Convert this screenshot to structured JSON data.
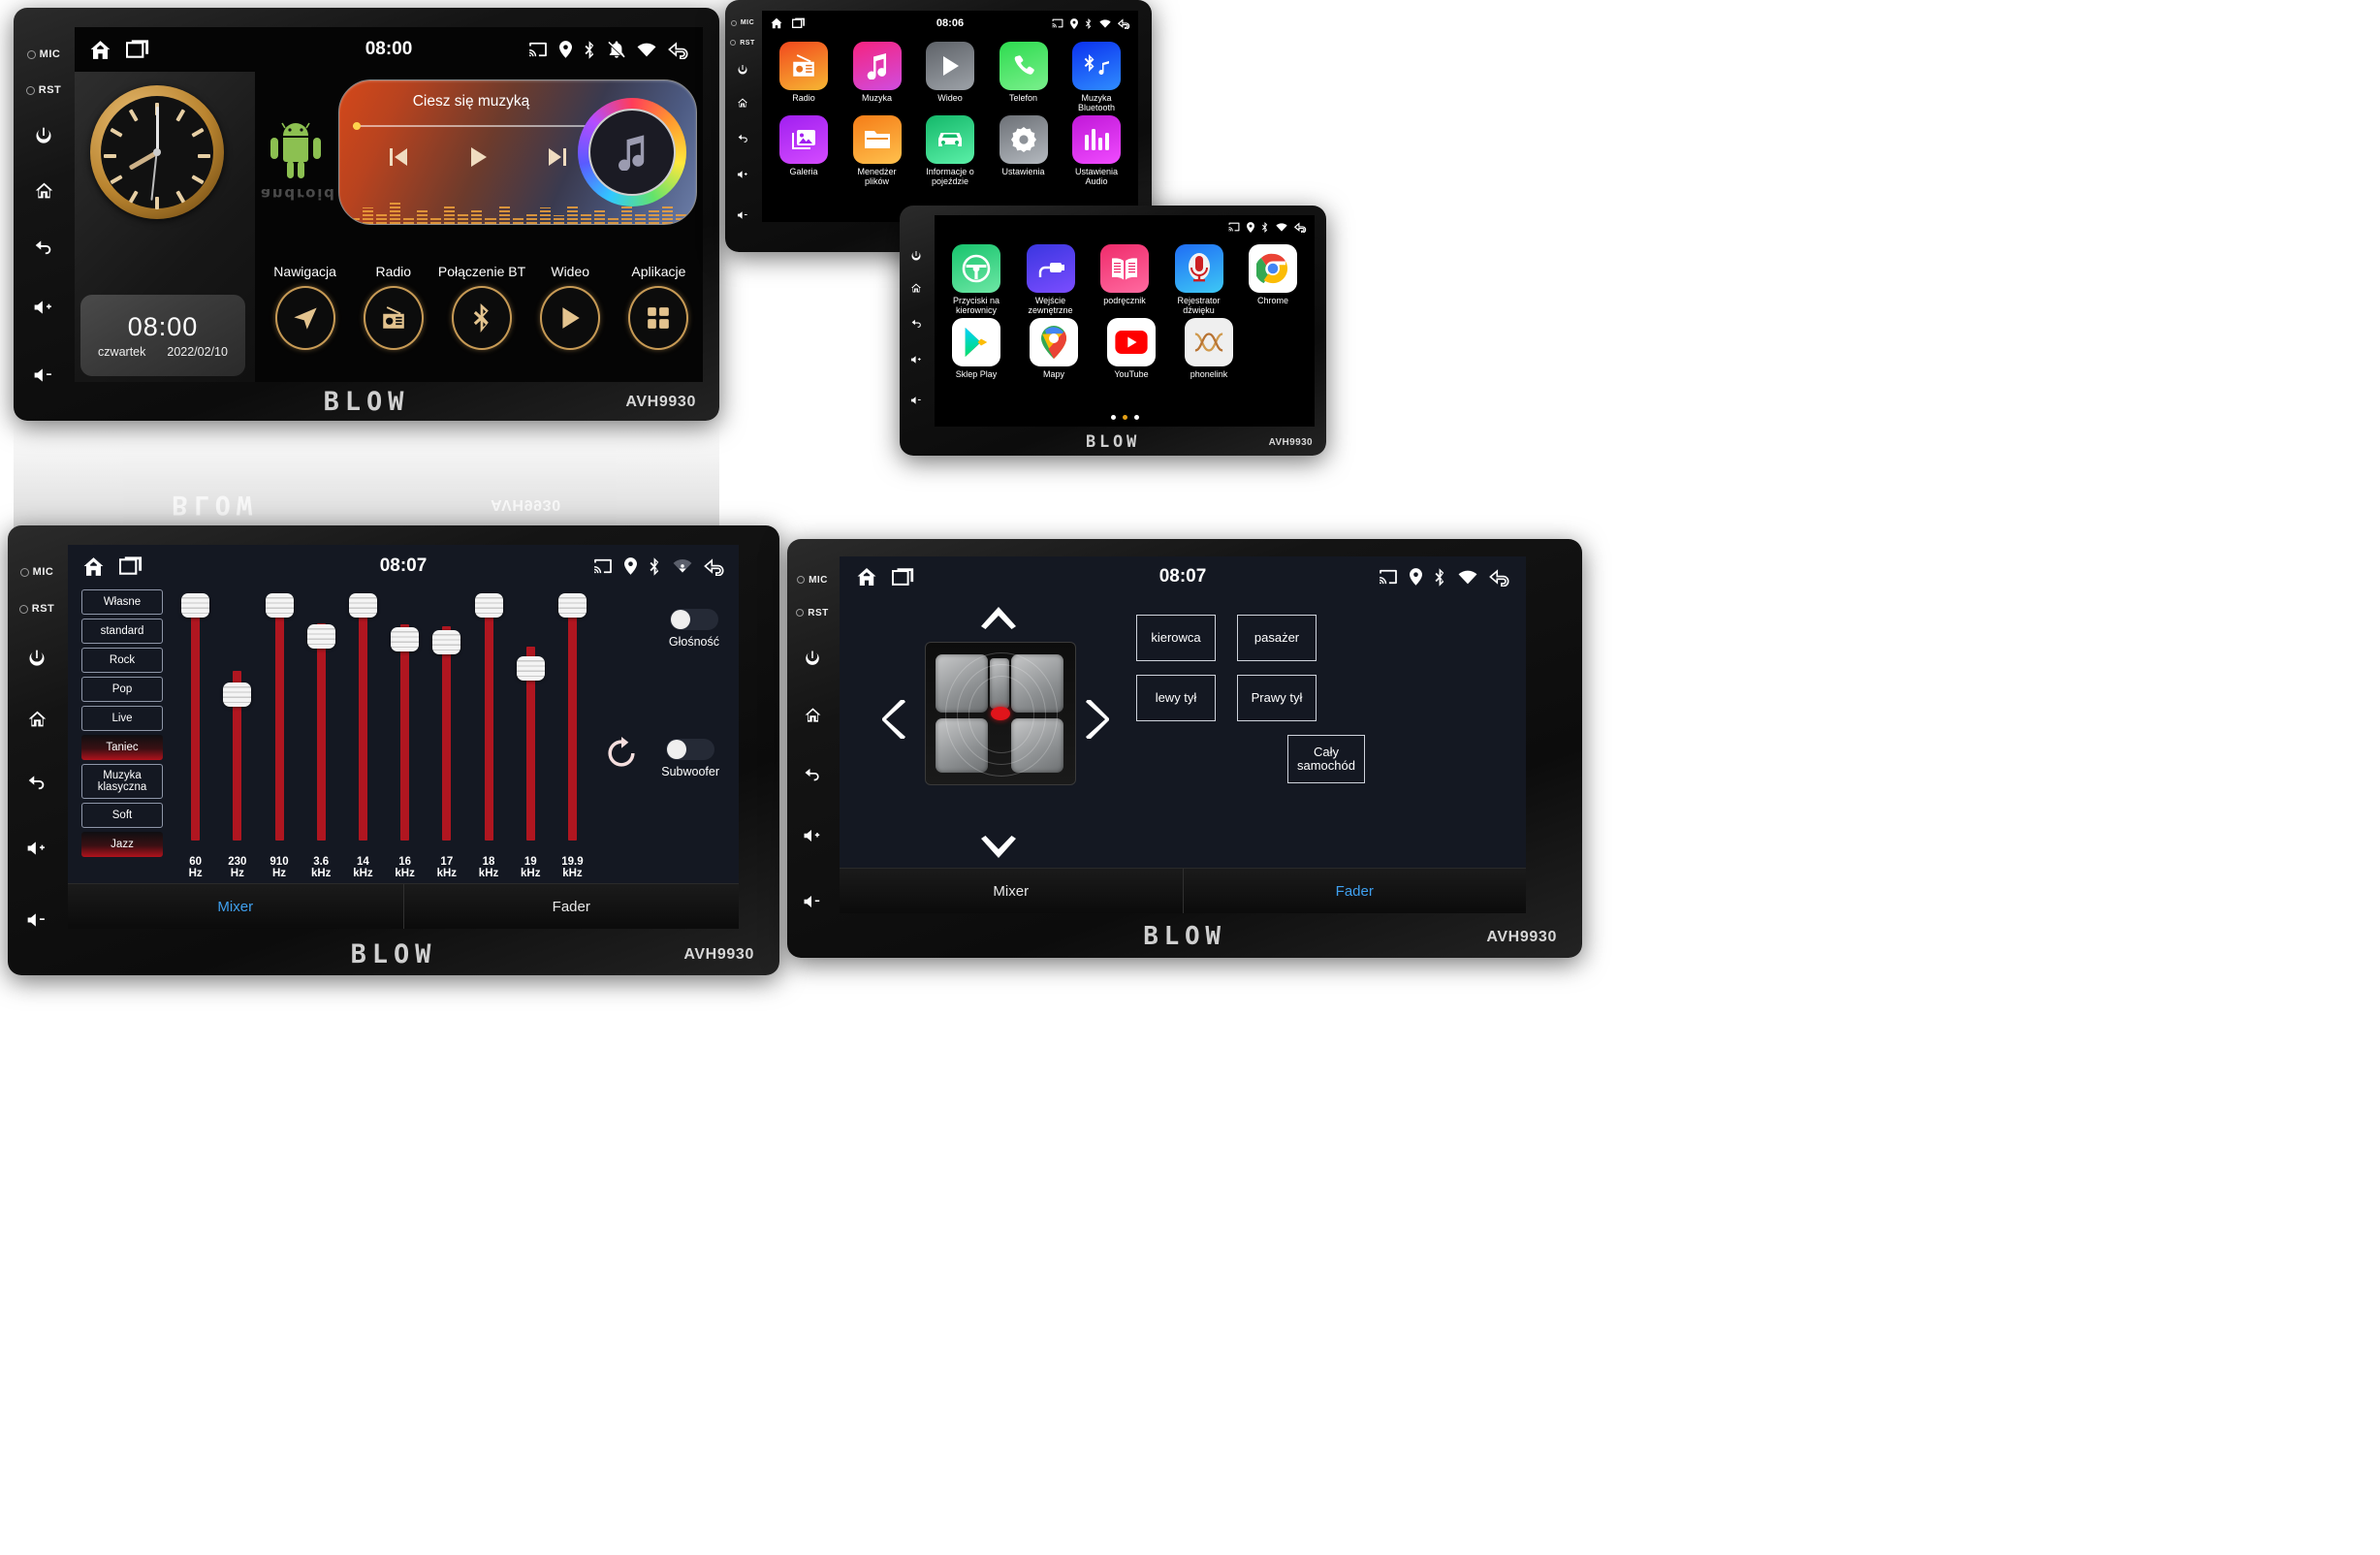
{
  "brand": {
    "name": "BLOW",
    "model": "AVH9930"
  },
  "side_buttons": [
    {
      "name": "mic-indicator",
      "label": "MIC",
      "type": "dot"
    },
    {
      "name": "reset-indicator",
      "label": "RST",
      "type": "dot"
    },
    {
      "name": "power-button",
      "label": "power-icon",
      "type": "icon"
    },
    {
      "name": "home-button",
      "label": "home-icon",
      "type": "icon"
    },
    {
      "name": "back-button",
      "label": "back-icon",
      "type": "icon"
    },
    {
      "name": "volume-up-button",
      "label": "volume-up-icon",
      "type": "icon"
    },
    {
      "name": "volume-down-button",
      "label": "volume-down-icon",
      "type": "icon"
    }
  ],
  "device_home": {
    "status": {
      "clock": "08:00",
      "left_icons": [
        "home-icon",
        "recents-icon"
      ],
      "right_icons": [
        "cast-icon",
        "location-icon",
        "bluetooth-icon",
        "notification-off-icon",
        "wifi-icon",
        "back-icon"
      ]
    },
    "analog_clock": {
      "hours": 8,
      "minutes": 0
    },
    "digital": {
      "time": "08:00",
      "weekday": "czwartek",
      "date": "2022/02/10"
    },
    "android_word": "android",
    "player": {
      "title": "Ciesz się muzyką",
      "progress_pct": 2,
      "controls": [
        "previous-icon",
        "play-icon",
        "next-icon"
      ],
      "album_icon": "music-note-icon"
    },
    "shortcuts": [
      {
        "label": "Nawigacja",
        "icon": "navigation-icon"
      },
      {
        "label": "Radio",
        "icon": "radio-icon"
      },
      {
        "label": "Połączenie BT",
        "icon": "bluetooth-icon"
      },
      {
        "label": "Wideo",
        "icon": "play-icon"
      },
      {
        "label": "Aplikacje",
        "icon": "apps-grid-icon"
      }
    ]
  },
  "device_apps1": {
    "status": {
      "clock": "08:06",
      "left_icons": [
        "home-icon",
        "recents-icon"
      ],
      "right_icons": [
        "cast-icon",
        "location-icon",
        "bluetooth-icon",
        "wifi-icon",
        "back-icon"
      ]
    },
    "rows": [
      [
        {
          "label": "Radio",
          "icon": "radio-icon",
          "color1": "#f2481d",
          "color2": "#f7b733"
        },
        {
          "label": "Muzyka",
          "icon": "music-note-icon",
          "color1": "#f5237f",
          "color2": "#d04de0"
        },
        {
          "label": "Wideo",
          "icon": "play-icon",
          "color1": "#5e6268",
          "color2": "#9da2a8"
        },
        {
          "label": "Telefon",
          "icon": "phone-icon",
          "color1": "#2ddb4f",
          "color2": "#7af08c"
        },
        {
          "label": "Muzyka Bluetooth",
          "icon": "bluetooth-music-icon",
          "color1": "#0b31ef",
          "color2": "#2f8dff"
        }
      ],
      [
        {
          "label": "Galeria",
          "icon": "gallery-icon",
          "color1": "#a01ff0",
          "color2": "#d44bff"
        },
        {
          "label": "Menedżer plików",
          "icon": "folder-icon",
          "color1": "#f57c17",
          "color2": "#ffc14d"
        },
        {
          "label": "Informacje o pojeździe",
          "icon": "car-icon",
          "color1": "#14b86a",
          "color2": "#5bf0a8"
        },
        {
          "label": "Ustawienia",
          "icon": "gear-icon",
          "color1": "#6c7076",
          "color2": "#b4b9bf"
        },
        {
          "label": "Ustawienia Audio",
          "icon": "equalizer-icon",
          "color1": "#c018d8",
          "color2": "#f04bff"
        }
      ]
    ],
    "page_dots": {
      "count": 3,
      "active": 0
    }
  },
  "device_apps2": {
    "status": {
      "right_icons": [
        "cast-icon",
        "location-icon",
        "bluetooth-icon",
        "wifi-icon",
        "back-icon"
      ]
    },
    "rows": [
      [
        {
          "label": "Przyciski na kierownicy",
          "icon": "steering-wheel-icon",
          "color1": "#17c46d",
          "color2": "#6ee7a5"
        },
        {
          "label": "Wejście zewnętrzne",
          "icon": "aux-plug-icon",
          "color1": "#3a36e0",
          "color2": "#7b4dff"
        },
        {
          "label": "podręcznik",
          "icon": "book-icon",
          "color1": "#ef2b6b",
          "color2": "#ff6aa0"
        },
        {
          "label": "Rejestrator dźwięku",
          "icon": "microphone-icon",
          "color1": "#1f6df5",
          "color2": "#3ec9f5"
        },
        {
          "label": "Chrome",
          "icon": "chrome-icon",
          "color1": "#ffffff",
          "color2": "#ffffff"
        }
      ],
      [
        {
          "label": "Sklep Play",
          "icon": "play-store-icon",
          "color1": "#ffffff",
          "color2": "#ffffff"
        },
        {
          "label": "Mapy",
          "icon": "google-maps-icon",
          "color1": "#ffffff",
          "color2": "#ffffff"
        },
        {
          "label": "YouTube",
          "icon": "youtube-icon",
          "color1": "#ffffff",
          "color2": "#ffffff"
        },
        {
          "label": "phonelink",
          "icon": "phonelink-icon",
          "color1": "#f1f1f1",
          "color2": "#e7e7e7"
        }
      ]
    ],
    "page_dots": {
      "count": 3,
      "active": 1
    }
  },
  "device_equalizer": {
    "status": {
      "clock": "08:07",
      "left_icons": [
        "home-icon",
        "recents-icon"
      ],
      "right_icons": [
        "cast-icon",
        "location-icon",
        "bluetooth-icon",
        "wifi-icon",
        "back-icon"
      ]
    },
    "presets": [
      {
        "label": "Własne",
        "active": false
      },
      {
        "label": "standard",
        "active": false
      },
      {
        "label": "Rock",
        "active": false
      },
      {
        "label": "Pop",
        "active": false
      },
      {
        "label": "Live",
        "active": false
      },
      {
        "label": "Taniec",
        "active": true
      },
      {
        "label": "Muzyka klasyczna",
        "active": false
      },
      {
        "label": "Soft",
        "active": false
      },
      {
        "label": "Jazz",
        "active": true
      }
    ],
    "bands": [
      {
        "freq": "60",
        "unit": "Hz",
        "level_pct": 100
      },
      {
        "freq": "230",
        "unit": "Hz",
        "level_pct": 66
      },
      {
        "freq": "910",
        "unit": "Hz",
        "level_pct": 100
      },
      {
        "freq": "3.6",
        "unit": "kHz",
        "level_pct": 88
      },
      {
        "freq": "14",
        "unit": "kHz",
        "level_pct": 100
      },
      {
        "freq": "16",
        "unit": "kHz",
        "level_pct": 87
      },
      {
        "freq": "17",
        "unit": "kHz",
        "level_pct": 86
      },
      {
        "freq": "18",
        "unit": "kHz",
        "level_pct": 100
      },
      {
        "freq": "19",
        "unit": "kHz",
        "level_pct": 76
      },
      {
        "freq": "19.9",
        "unit": "kHz",
        "level_pct": 100
      }
    ],
    "toggles": [
      {
        "label": "Głośność",
        "on": false
      },
      {
        "label": "Subwoofer",
        "on": false
      }
    ],
    "reset_icon": "reset-icon",
    "tabs": [
      {
        "label": "Mixer",
        "active": true
      },
      {
        "label": "Fader",
        "active": false
      }
    ]
  },
  "device_fader": {
    "status": {
      "clock": "08:07",
      "left_icons": [
        "home-icon",
        "recents-icon"
      ],
      "right_icons": [
        "cast-icon",
        "location-icon",
        "bluetooth-icon",
        "wifi-icon",
        "back-icon"
      ]
    },
    "arrows": [
      "up-arrow-icon",
      "down-arrow-icon",
      "left-arrow-icon",
      "right-arrow-icon"
    ],
    "zones": [
      {
        "label": "kierowca"
      },
      {
        "label": "pasażer"
      },
      {
        "label": "lewy tył"
      },
      {
        "label": "Prawy tył"
      },
      {
        "label": "Cały samochód"
      }
    ],
    "tabs": [
      {
        "label": "Mixer",
        "active": false
      },
      {
        "label": "Fader",
        "active": true
      }
    ]
  },
  "colors": {
    "accent_blue": "#3fa0ef",
    "eq_red": "#b01620",
    "gold": "#c79a55",
    "dot_red": "#e0151b"
  }
}
